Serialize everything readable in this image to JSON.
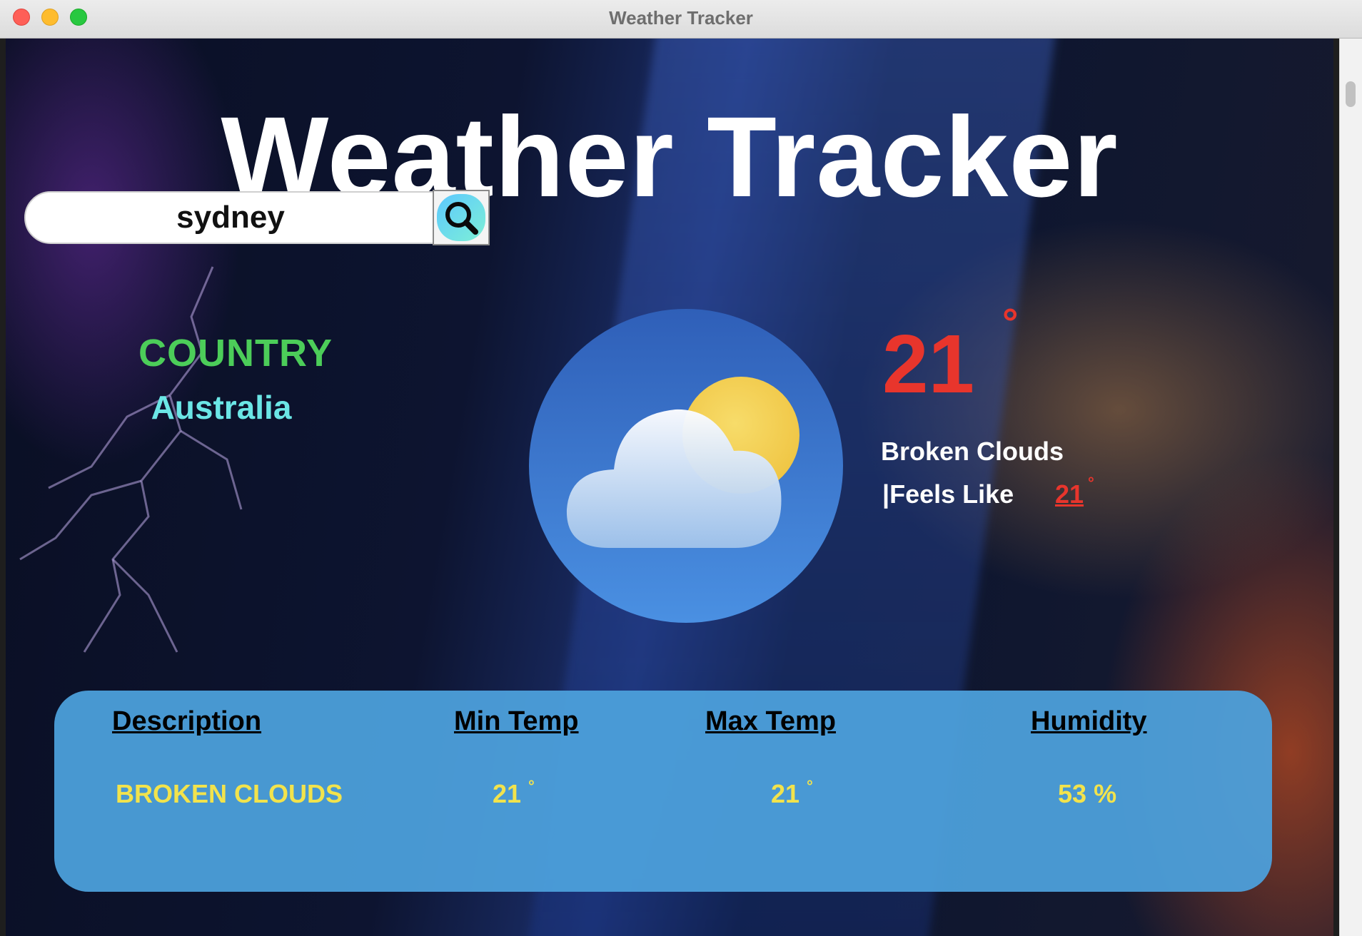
{
  "window": {
    "title": "Weather Tracker"
  },
  "app": {
    "title": "Weather Tracker"
  },
  "search": {
    "value": "sydney",
    "icon": "search-icon"
  },
  "location": {
    "label": "COUNTRY",
    "country": "Australia"
  },
  "current": {
    "temperature": "21",
    "degree_symbol": "°",
    "condition": "Broken Clouds",
    "feels_like_label": "|Feels Like",
    "feels_like_value": "21",
    "icon": "partly-cloudy-icon"
  },
  "details": {
    "headers": [
      "Description",
      "Min Temp",
      "Max Temp",
      "Humidity"
    ],
    "values": {
      "description": "BROKEN CLOUDS",
      "min_temp": "21",
      "max_temp": "21",
      "humidity": "53",
      "humidity_unit": "%",
      "degree_symbol": "°"
    }
  },
  "colors": {
    "temperature": "#e8352c",
    "country_label": "#4ccd59",
    "country_value": "#6be6e6",
    "panel": "#4ca0dc",
    "panel_values": "#f2e34c"
  }
}
